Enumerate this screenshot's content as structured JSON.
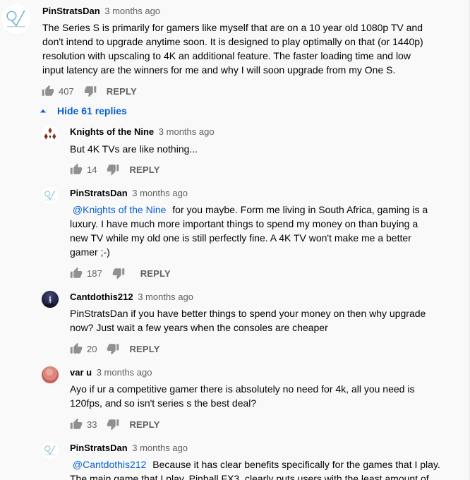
{
  "thread": {
    "top_comment": {
      "author": "PinStratsDan",
      "time": "3 months ago",
      "avatar_icon": "pinstratsdan-logo-icon",
      "lines": [
        "The Series S is primarily for gamers like myself that are on a 10 year old 1080p TV and",
        "don't intend to upgrade anytime soon. It is designed to play optimally on that (or 1440p)",
        "resolution with upscaling to 4K an additional feature.  The faster loading time and low",
        "input latency are the winners for me and why I will soon upgrade from my One S."
      ],
      "likes": "407",
      "reply_label": "REPLY"
    },
    "hide_replies_label": "Hide 61 replies",
    "replies": [
      {
        "author": "Knights of the Nine",
        "time": "3 months ago",
        "avatar_icon": "knights-diamond-logo-icon",
        "mention": "",
        "lines": [
          "But 4K TVs are like nothing..."
        ],
        "likes": "14",
        "reply_label": "REPLY"
      },
      {
        "author": "PinStratsDan",
        "time": "3 months ago",
        "avatar_icon": "pinstratsdan-logo-icon",
        "mention": "@Knights of the Nine",
        "lines": [
          "for you maybe.  Form me living in South Africa, gaming is a",
          "luxury.  I have much more important things to spend my money on than buying a",
          "new TV while my old one is still perfectly fine.  A 4K TV won't make me a better",
          "gamer ;-)"
        ],
        "likes": "187",
        "reply_label": "REPLY"
      },
      {
        "author": "Cantdothis212",
        "time": "3 months ago",
        "avatar_icon": "night-figure-avatar-icon",
        "mention": "",
        "lines": [
          "PinStratsDan if you have better things to spend your money on then why upgrade",
          "now? Just wait a few years when the consoles are cheaper"
        ],
        "likes": "20",
        "reply_label": "REPLY"
      },
      {
        "author": "var u",
        "time": "3 months ago",
        "avatar_icon": "rose-gradient-avatar-icon",
        "mention": "",
        "lines": [
          "Ayo if ur a competitive gamer there is absolutely no need for 4k, all you need is",
          "120fps, and so isn't series s the best deal?"
        ],
        "likes": "33",
        "reply_label": "REPLY"
      },
      {
        "author": "PinStratsDan",
        "time": "3 months ago",
        "avatar_icon": "pinstratsdan-logo-icon",
        "mention": "@Cantdothis212",
        "lines": [
          "Because it has clear benefits specifically for the games that I play.",
          "The main game that I play, Pinball FX3, clearly puts users with the least amount of"
        ],
        "likes": "",
        "reply_label": ""
      }
    ]
  },
  "colors": {
    "background": "#f9f9f9",
    "text": "#030303",
    "secondary_text": "#606060",
    "link_blue": "#065fd4",
    "logo_teal": "#6fb3c7"
  },
  "icons": {
    "like": "thumbs-up-icon",
    "dislike": "thumbs-down-icon",
    "collapse": "caret-up-icon"
  }
}
